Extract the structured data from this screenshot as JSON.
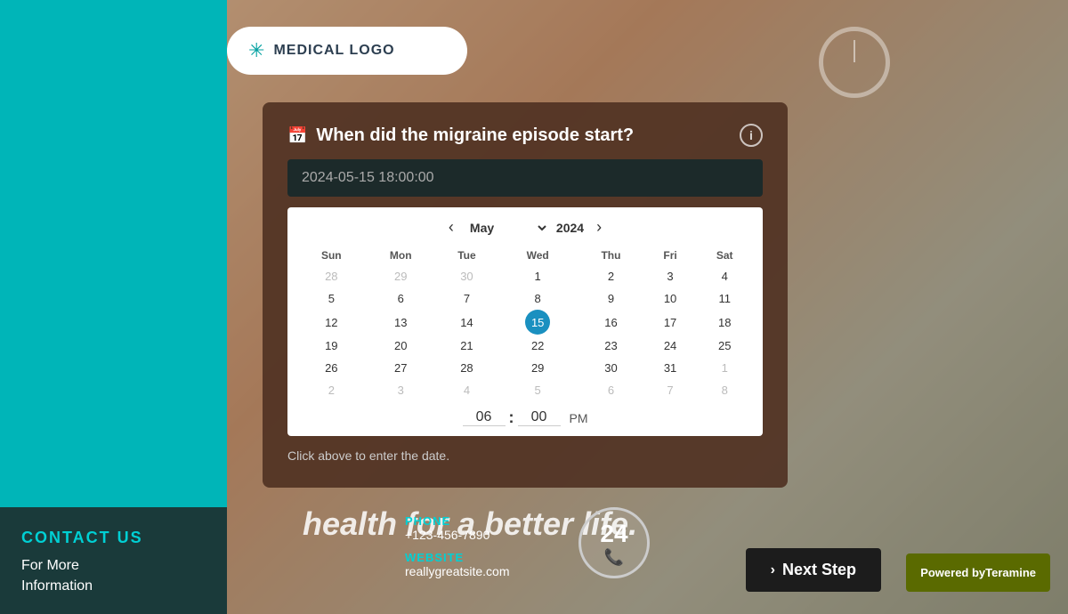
{
  "background": {
    "color": "#00b5b8",
    "image_text": "health for a better life."
  },
  "logo": {
    "text": "MEDICAL LOGO",
    "icon": "✳"
  },
  "modal": {
    "title": "When did the migraine episode start?",
    "date_input_value": "2024-05-15 18:00:00",
    "info_icon_label": "i",
    "calendar_icon": "📅",
    "month": "May",
    "year": "2024",
    "days_header": [
      "Sun",
      "Mon",
      "Tue",
      "Wed",
      "Thu",
      "Fri",
      "Sat"
    ],
    "rows": [
      [
        "28",
        "29",
        "30",
        "1",
        "2",
        "3",
        "4"
      ],
      [
        "5",
        "6",
        "7",
        "8",
        "9",
        "10",
        "11"
      ],
      [
        "12",
        "13",
        "14",
        "15",
        "16",
        "17",
        "18"
      ],
      [
        "19",
        "20",
        "21",
        "22",
        "23",
        "24",
        "25"
      ],
      [
        "26",
        "27",
        "28",
        "29",
        "30",
        "31",
        "1"
      ],
      [
        "2",
        "3",
        "4",
        "5",
        "6",
        "7",
        "8"
      ]
    ],
    "other_month_cells": {
      "row0": [
        true,
        true,
        true,
        false,
        false,
        false,
        false
      ],
      "row1": [
        false,
        false,
        false,
        false,
        false,
        false,
        false
      ],
      "row2": [
        false,
        false,
        false,
        false,
        false,
        false,
        false
      ],
      "row3": [
        false,
        false,
        false,
        false,
        false,
        false,
        false
      ],
      "row4": [
        false,
        false,
        false,
        false,
        false,
        false,
        true
      ],
      "row5": [
        true,
        true,
        true,
        true,
        true,
        true,
        true
      ]
    },
    "selected_day": "15",
    "selected_row": 2,
    "selected_col": 3,
    "time_hours": "06",
    "time_separator": ":",
    "time_minutes": "00",
    "time_ampm": "PM",
    "help_text": "Click above to enter the date."
  },
  "contact": {
    "title": "CONTACT US",
    "description": "For More\nInformation",
    "phone_label": "PHONE",
    "phone_value": "+123-456-7890",
    "website_label": "WEBSITE",
    "website_value": "reallygreatsite.com"
  },
  "badge": {
    "number": "24",
    "icon": "📞"
  },
  "next_step": {
    "label": "Next Step",
    "arrow": "›"
  },
  "powered_by": {
    "prefix": "Powered by",
    "brand": "Teramine"
  }
}
